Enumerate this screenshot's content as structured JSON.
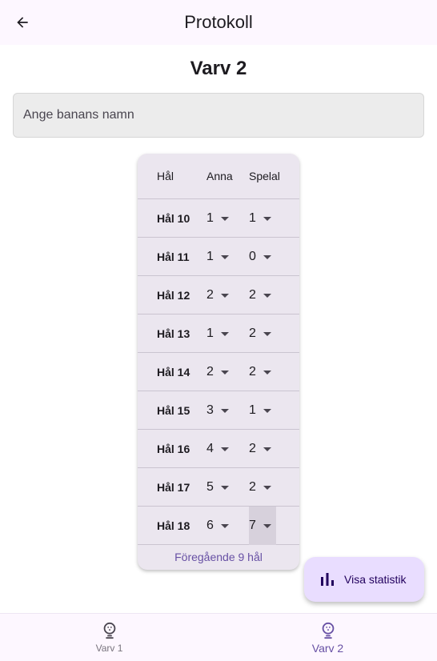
{
  "appbar": {
    "title": "Protokoll"
  },
  "round_title": "Varv 2",
  "course_input": {
    "placeholder": "Ange banans namn",
    "value": ""
  },
  "table": {
    "headers": {
      "hole": "Hål",
      "player1": "Anna",
      "player2": "Spelal"
    },
    "rows": [
      {
        "hole": "Hål 10",
        "p1": "1",
        "p2": "1"
      },
      {
        "hole": "Hål 11",
        "p1": "1",
        "p2": "0"
      },
      {
        "hole": "Hål 12",
        "p1": "2",
        "p2": "2"
      },
      {
        "hole": "Hål 13",
        "p1": "1",
        "p2": "2"
      },
      {
        "hole": "Hål 14",
        "p1": "2",
        "p2": "2"
      },
      {
        "hole": "Hål 15",
        "p1": "3",
        "p2": "1"
      },
      {
        "hole": "Hål 16",
        "p1": "4",
        "p2": "2"
      },
      {
        "hole": "Hål 17",
        "p1": "5",
        "p2": "2"
      },
      {
        "hole": "Hål 18",
        "p1": "6",
        "p2": "7"
      }
    ],
    "prev_link": "Föregående 9 hål"
  },
  "fab": {
    "label": "Visa statistik",
    "icon": "bar-chart-icon"
  },
  "bottom_nav": {
    "items": [
      {
        "label": "Varv 1",
        "icon": "golf-icon",
        "active": false
      },
      {
        "label": "Varv 2",
        "icon": "golf-icon",
        "active": true
      }
    ]
  },
  "colors": {
    "accent": "#6750a4",
    "card": "#ebe6ef",
    "fab": "#e9ddff",
    "appbar": "#fdf7ff"
  }
}
